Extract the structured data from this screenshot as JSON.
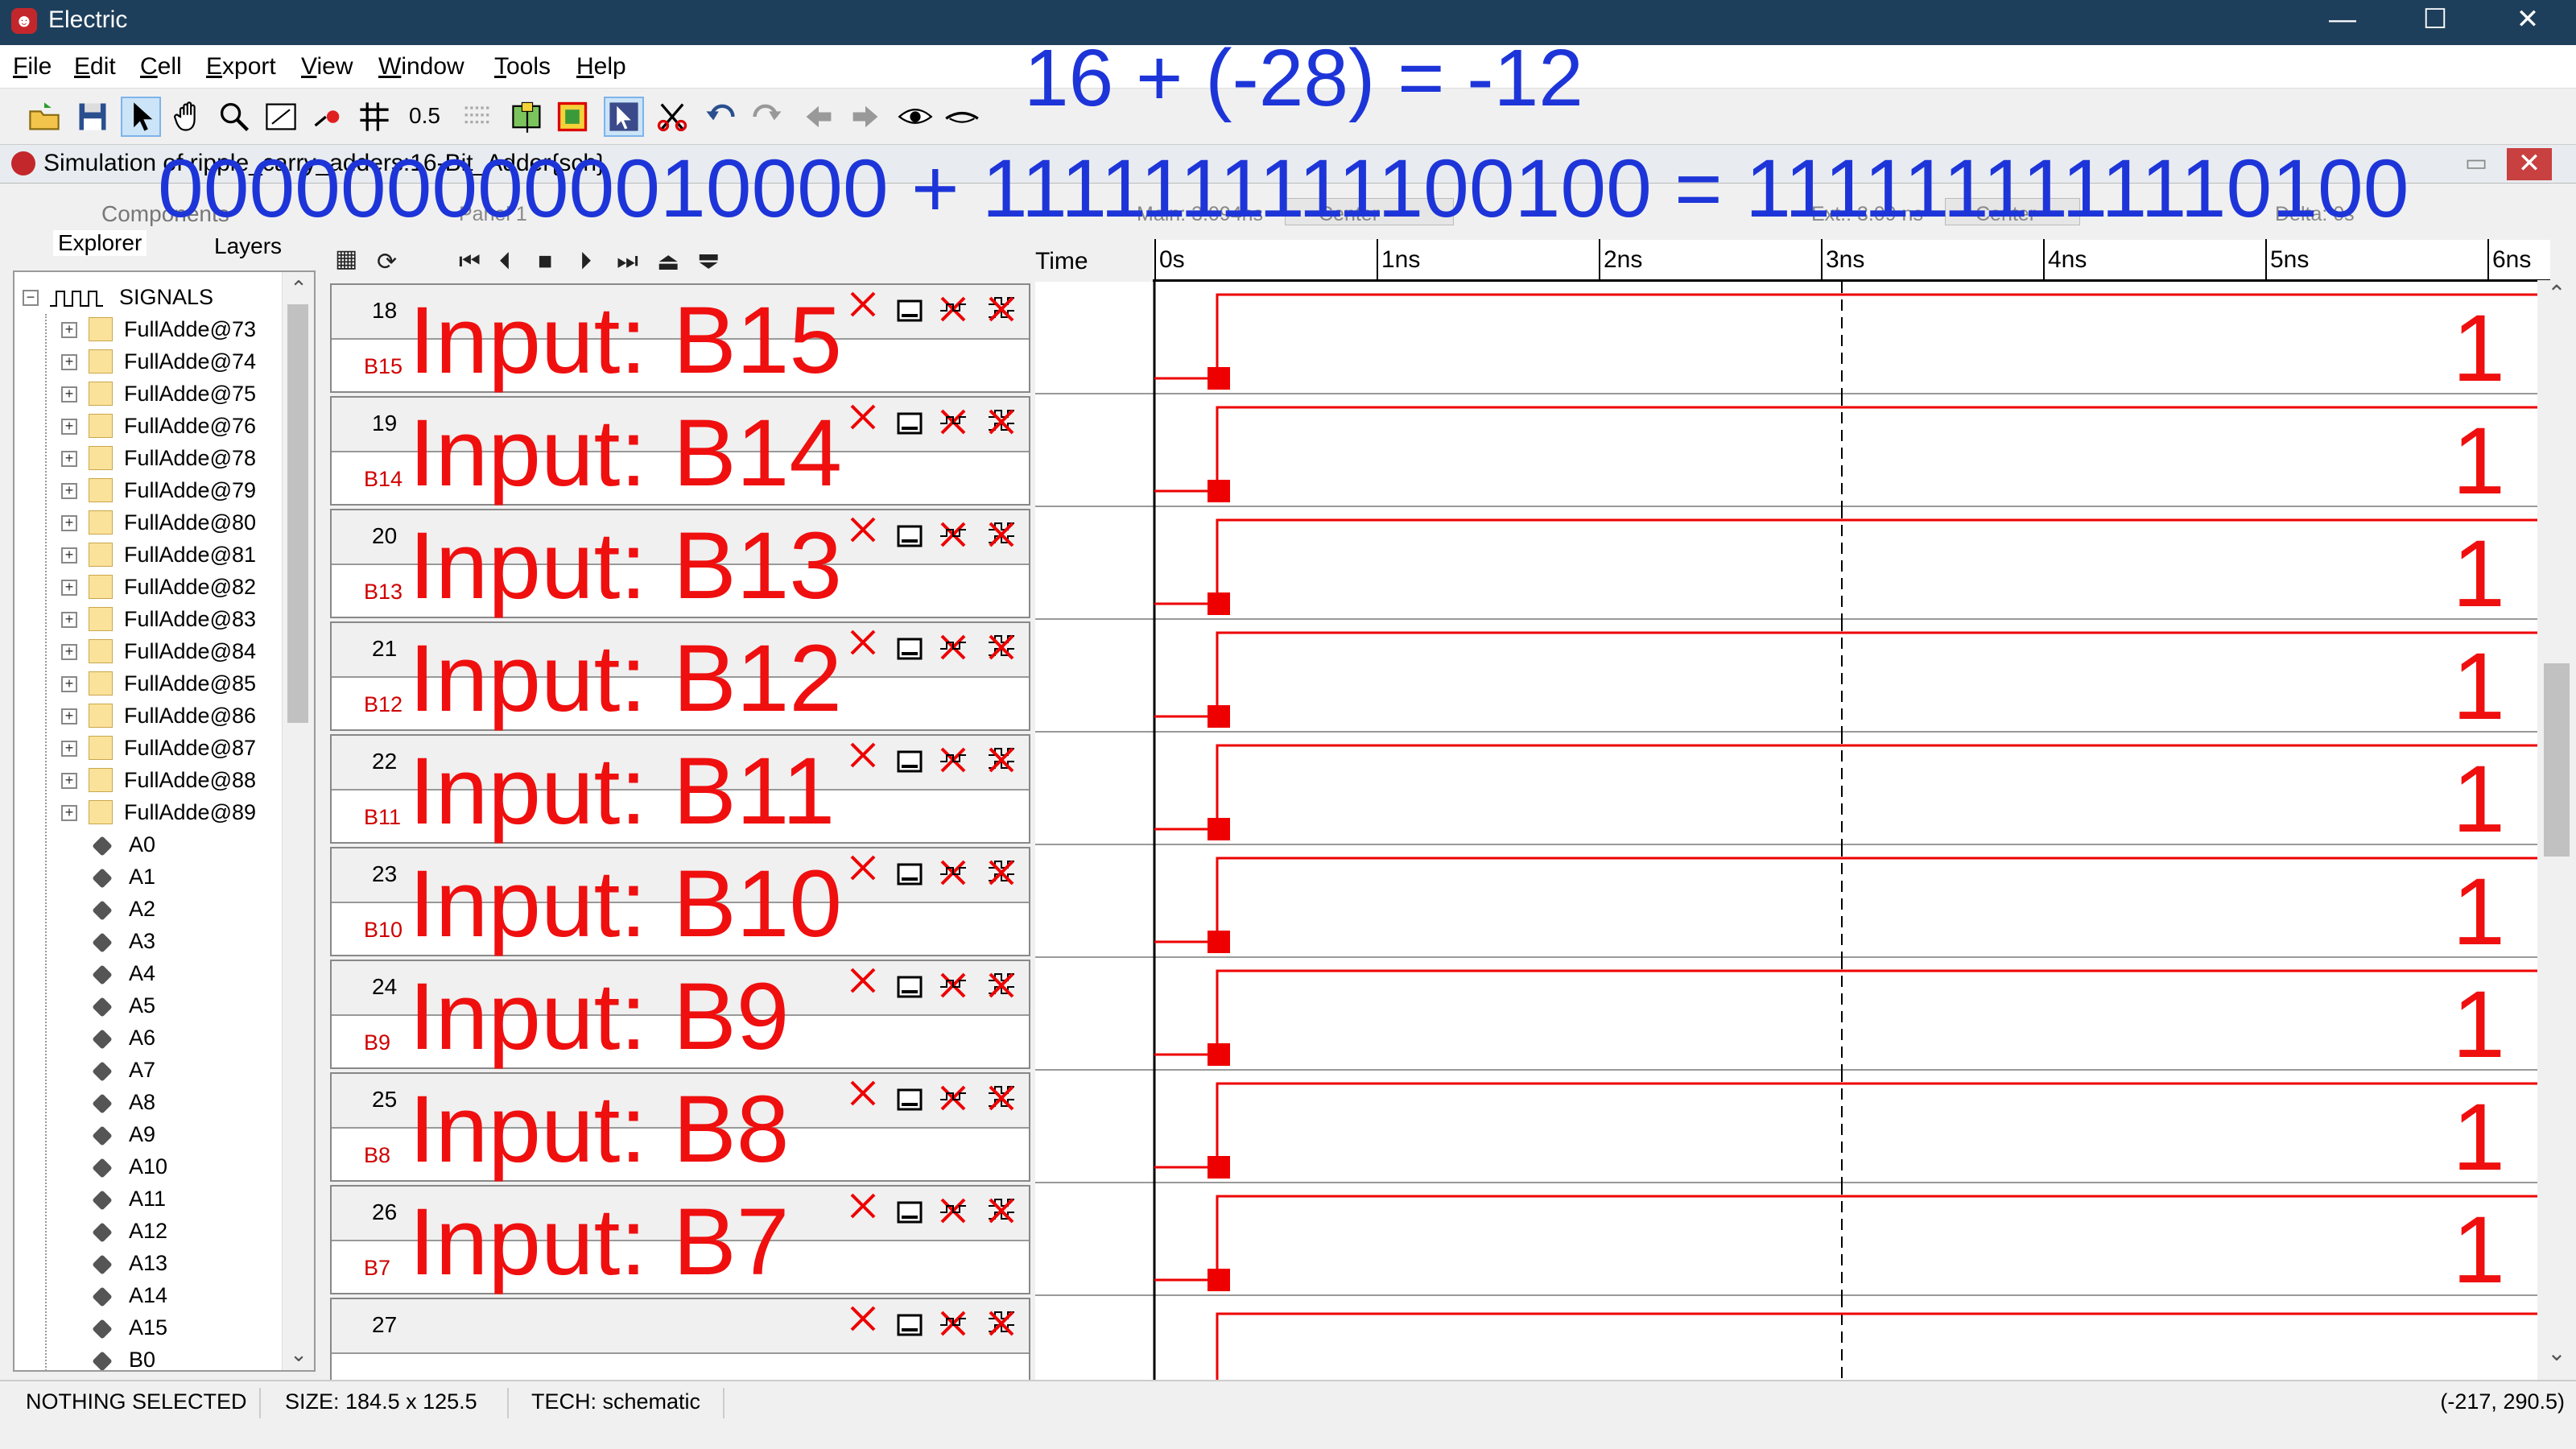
{
  "window": {
    "title": "Electric",
    "minimize": "—",
    "maximize": "☐",
    "close": "✕"
  },
  "menu": [
    "File",
    "Edit",
    "Cell",
    "Export",
    "View",
    "Window",
    "Tools",
    "Help"
  ],
  "toolbar": {
    "zoom_value": "0.5"
  },
  "document": {
    "title": "Simulation of ripple_carry_adders:16-Bit_Adder{sch}"
  },
  "overlay": {
    "equation_decimal": "16 + (-28) = -12",
    "equation_binary": "0000000000010000 + 1111111111100100 = 1111111111110100"
  },
  "sidebar": {
    "tab_components": "Components",
    "tab_explorer": "Explorer",
    "tab_layers": "Layers",
    "root": "SIGNALS",
    "folders": [
      "FullAdde@73",
      "FullAdde@74",
      "FullAdde@75",
      "FullAdde@76",
      "FullAdde@78",
      "FullAdde@79",
      "FullAdde@80",
      "FullAdde@81",
      "FullAdde@82",
      "FullAdde@83",
      "FullAdde@84",
      "FullAdde@85",
      "FullAdde@86",
      "FullAdde@87",
      "FullAdde@88",
      "FullAdde@89"
    ],
    "signals": [
      "A0",
      "A1",
      "A2",
      "A3",
      "A4",
      "A5",
      "A6",
      "A7",
      "A8",
      "A9",
      "A10",
      "A11",
      "A12",
      "A13",
      "A14",
      "A15",
      "B0"
    ]
  },
  "waveform": {
    "panel_label": "Panel 1",
    "main_label": "Main: 3.094ns",
    "center1": "Center",
    "ext_label": "Ext.: 3.09 ns",
    "center2": "Center",
    "delta_label": "Delta: 0s",
    "time_label": "Time",
    "ticks": [
      "0s",
      "1ns",
      "2ns",
      "3ns",
      "4ns",
      "5ns",
      "6ns"
    ],
    "traces": [
      {
        "num": "18",
        "signal": "B15",
        "overlay": "Input: B15",
        "value": "1"
      },
      {
        "num": "19",
        "signal": "B14",
        "overlay": "Input: B14",
        "value": "1"
      },
      {
        "num": "20",
        "signal": "B13",
        "overlay": "Input: B13",
        "value": "1"
      },
      {
        "num": "21",
        "signal": "B12",
        "overlay": "Input: B12",
        "value": "1"
      },
      {
        "num": "22",
        "signal": "B11",
        "overlay": "Input: B11",
        "value": "1"
      },
      {
        "num": "23",
        "signal": "B10",
        "overlay": "Input: B10",
        "value": "1"
      },
      {
        "num": "24",
        "signal": "B9",
        "overlay": "Input: B9",
        "value": "1"
      },
      {
        "num": "25",
        "signal": "B8",
        "overlay": "Input: B8",
        "value": "1"
      },
      {
        "num": "26",
        "signal": "B7",
        "overlay": "Input: B7",
        "value": "1"
      },
      {
        "num": "27",
        "signal": "",
        "overlay": "",
        "value": ""
      }
    ]
  },
  "status": {
    "selection": "NOTHING SELECTED",
    "size": "SIZE: 184.5 x 125.5",
    "tech": "TECH: schematic",
    "coords": "(-217, 290.5)"
  },
  "colors": {
    "signal": "#ef0f0f",
    "overlay_blue": "#1d35d8",
    "titlebar": "#1e3f5b"
  }
}
